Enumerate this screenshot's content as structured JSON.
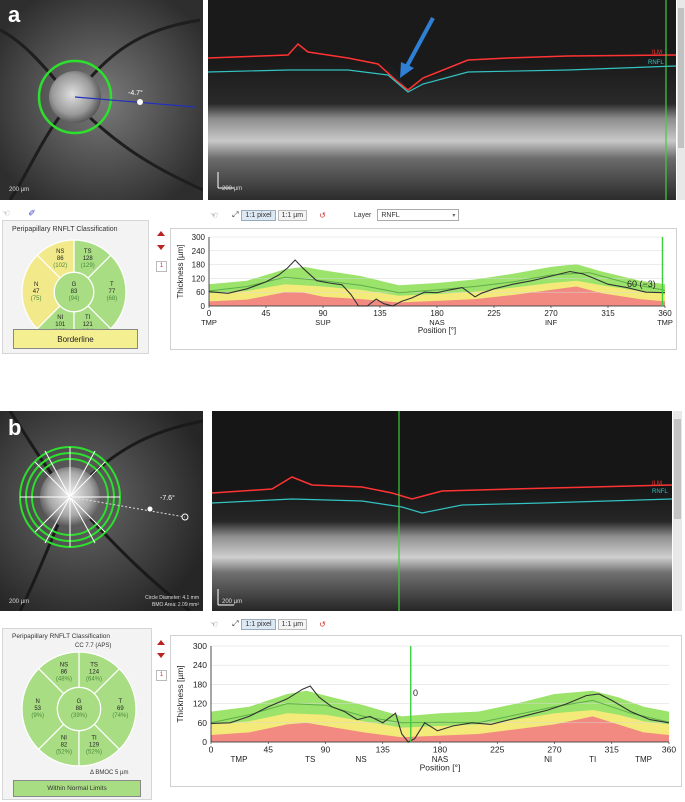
{
  "panels": [
    {
      "label": "a",
      "fundus": {
        "scale_bar": "200 µm",
        "angle_label": "-4.7°",
        "circle_diameter": "",
        "bmo_area": ""
      },
      "oct": {
        "scale_bar": "200 µm",
        "ilm_label": "ILM",
        "rnfl_label": "RNFL"
      },
      "toolbar": {
        "btn1": "1:1 pixel",
        "btn2": "1:1 µm",
        "layer_label": "Layer",
        "layer_value": "RNFL"
      },
      "classification": {
        "title": "Peripapillary RNFLT Classification",
        "extra": "",
        "bmoc": "",
        "sectors": {
          "NS": {
            "name": "NS",
            "value": "86",
            "ref": "(102)",
            "color": "#f2ea8a"
          },
          "TS": {
            "name": "TS",
            "value": "128",
            "ref": "(129)",
            "color": "#a9dd84"
          },
          "N": {
            "name": "N",
            "value": "47",
            "ref": "(75)",
            "color": "#f2ea8a"
          },
          "G": {
            "name": "G",
            "value": "83",
            "ref": "(94)",
            "color": "#a9dd84"
          },
          "T": {
            "name": "T",
            "value": "77",
            "ref": "(68)",
            "color": "#a9dd84"
          },
          "NI": {
            "name": "NI",
            "value": "101",
            "ref": "(103)",
            "color": "#a9dd84"
          },
          "TI": {
            "name": "TI",
            "value": "121",
            "ref": "(134)",
            "color": "#a9dd84"
          }
        },
        "status": "Borderline",
        "status_color": "#f4ef90"
      },
      "page": "1",
      "annotation": "60 (−3)"
    },
    {
      "label": "b",
      "fundus": {
        "scale_bar": "200 µm",
        "angle_label": "-7.6°",
        "circle_diameter": "Circle Diameter: 4.1 mm",
        "bmo_area": "BMO Area: 2.09 mm²"
      },
      "oct": {
        "scale_bar": "200 µm",
        "ilm_label": "ILM",
        "rnfl_label": "RNFL"
      },
      "toolbar": {
        "btn1": "1:1 pixel",
        "btn2": "1:1 µm",
        "layer_label": "",
        "layer_value": ""
      },
      "classification": {
        "title": "Peripapillary RNFLT Classification",
        "extra": "CC 7.7 (APS)",
        "bmoc": "Δ BMOC 5 µm",
        "sectors": {
          "NS": {
            "name": "NS",
            "value": "86",
            "ref": "(48%)",
            "color": "#a9dd84"
          },
          "TS": {
            "name": "TS",
            "value": "124",
            "ref": "(64%)",
            "color": "#a9dd84"
          },
          "N": {
            "name": "N",
            "value": "53",
            "ref": "(9%)",
            "color": "#a9dd84"
          },
          "G": {
            "name": "G",
            "value": "88",
            "ref": "(39%)",
            "color": "#a9dd84"
          },
          "T": {
            "name": "T",
            "value": "69",
            "ref": "(74%)",
            "color": "#a9dd84"
          },
          "NI": {
            "name": "NI",
            "value": "82",
            "ref": "(52%)",
            "color": "#a9dd84"
          },
          "TI": {
            "name": "TI",
            "value": "129",
            "ref": "(52%)",
            "color": "#a9dd84"
          }
        },
        "status": "Within Normal Limits",
        "status_color": "#a9dd84"
      },
      "page": "1",
      "annotation": "0"
    }
  ],
  "colors": {
    "ilm": "#ff3333",
    "rnfl": "#33c3c3",
    "cursor": "#3ccf3c",
    "arrow": "#2f7fd4",
    "normal_band": "#9be36a",
    "borderline_band": "#f4ea7a",
    "abnormal_band": "#f28a82"
  },
  "chart_data": [
    {
      "type": "line",
      "ylabel": "Thickness [µm]",
      "xlabel": "Position [°]",
      "ylim": [
        0,
        300
      ],
      "xlim": [
        0,
        360
      ],
      "yticks": [
        "0",
        "60",
        "120",
        "180",
        "240",
        "300"
      ],
      "xticks": [
        "0",
        "45",
        "90",
        "135",
        "180",
        "225",
        "270",
        "315",
        "360"
      ],
      "xcats": [
        "TMP",
        "SUP",
        "NAS",
        "INF",
        "TMP"
      ],
      "cursor_x": 358,
      "series": [
        {
          "values": [
            [
              0,
              62
            ],
            [
              15,
              55
            ],
            [
              30,
              75
            ],
            [
              45,
              105
            ],
            [
              55,
              135
            ],
            [
              62,
              165
            ],
            [
              68,
              200
            ],
            [
              75,
              160
            ],
            [
              85,
              110
            ],
            [
              95,
              100
            ],
            [
              105,
              92
            ],
            [
              112,
              50
            ],
            [
              118,
              0
            ],
            [
              125,
              0
            ],
            [
              132,
              30
            ],
            [
              138,
              10
            ],
            [
              145,
              0
            ],
            [
              152,
              20
            ],
            [
              160,
              35
            ],
            [
              170,
              60
            ],
            [
              180,
              58
            ],
            [
              190,
              70
            ],
            [
              200,
              80
            ],
            [
              210,
              40
            ],
            [
              215,
              55
            ],
            [
              225,
              75
            ],
            [
              240,
              95
            ],
            [
              255,
              110
            ],
            [
              270,
              130
            ],
            [
              285,
              150
            ],
            [
              295,
              140
            ],
            [
              305,
              118
            ],
            [
              315,
              95
            ],
            [
              330,
              80
            ],
            [
              345,
              60
            ],
            [
              360,
              58
            ]
          ]
        },
        {
          "values": [
            [
              0,
              65
            ],
            [
              30,
              85
            ],
            [
              60,
              125
            ],
            [
              90,
              110
            ],
            [
              120,
              90
            ],
            [
              150,
              58
            ],
            [
              180,
              70
            ],
            [
              210,
              85
            ],
            [
              240,
              105
            ],
            [
              270,
              135
            ],
            [
              300,
              145
            ],
            [
              330,
              100
            ],
            [
              360,
              68
            ]
          ]
        }
      ],
      "bands": {
        "normal_upper": [
          [
            0,
            95
          ],
          [
            30,
            110
          ],
          [
            60,
            160
          ],
          [
            75,
            170
          ],
          [
            90,
            155
          ],
          [
            120,
            130
          ],
          [
            150,
            90
          ],
          [
            180,
            100
          ],
          [
            210,
            115
          ],
          [
            240,
            140
          ],
          [
            270,
            170
          ],
          [
            290,
            182
          ],
          [
            310,
            150
          ],
          [
            340,
            110
          ],
          [
            360,
            95
          ]
        ],
        "borderline_upper": [
          [
            0,
            55
          ],
          [
            30,
            65
          ],
          [
            60,
            95
          ],
          [
            90,
            85
          ],
          [
            120,
            70
          ],
          [
            150,
            45
          ],
          [
            180,
            52
          ],
          [
            210,
            62
          ],
          [
            240,
            80
          ],
          [
            270,
            100
          ],
          [
            290,
            110
          ],
          [
            310,
            90
          ],
          [
            340,
            65
          ],
          [
            360,
            55
          ]
        ],
        "abnormal_upper": [
          [
            0,
            20
          ],
          [
            30,
            28
          ],
          [
            60,
            60
          ],
          [
            75,
            58
          ],
          [
            90,
            40
          ],
          [
            120,
            30
          ],
          [
            150,
            15
          ],
          [
            180,
            22
          ],
          [
            210,
            30
          ],
          [
            240,
            48
          ],
          [
            270,
            70
          ],
          [
            290,
            85
          ],
          [
            310,
            55
          ],
          [
            340,
            30
          ],
          [
            360,
            20
          ]
        ]
      }
    },
    {
      "type": "line",
      "ylabel": "Thickness [µm]",
      "xlabel": "Position [°]",
      "ylim": [
        0,
        300
      ],
      "xlim": [
        0,
        360
      ],
      "yticks": [
        "0",
        "60",
        "120",
        "180",
        "240",
        "300"
      ],
      "xticks": [
        "0",
        "45",
        "90",
        "135",
        "180",
        "225",
        "270",
        "315",
        "360"
      ],
      "xcats": [
        "TMP",
        "TS",
        "NS",
        "NAS",
        "NI",
        "TI",
        "TMP"
      ],
      "cursor_x": 157,
      "series": [
        {
          "values": [
            [
              0,
              58
            ],
            [
              15,
              60
            ],
            [
              30,
              80
            ],
            [
              45,
              110
            ],
            [
              60,
              135
            ],
            [
              72,
              165
            ],
            [
              78,
              175
            ],
            [
              85,
              140
            ],
            [
              95,
              110
            ],
            [
              105,
              95
            ],
            [
              115,
              70
            ],
            [
              125,
              80
            ],
            [
              135,
              60
            ],
            [
              145,
              90
            ],
            [
              150,
              25
            ],
            [
              155,
              0
            ],
            [
              160,
              10
            ],
            [
              168,
              60
            ],
            [
              178,
              35
            ],
            [
              190,
              50
            ],
            [
              205,
              60
            ],
            [
              220,
              55
            ],
            [
              235,
              70
            ],
            [
              250,
              85
            ],
            [
              265,
              100
            ],
            [
              280,
              120
            ],
            [
              295,
              145
            ],
            [
              305,
              150
            ],
            [
              315,
              130
            ],
            [
              330,
              95
            ],
            [
              345,
              70
            ],
            [
              360,
              60
            ]
          ]
        },
        {
          "values": [
            [
              0,
              60
            ],
            [
              30,
              85
            ],
            [
              60,
              120
            ],
            [
              90,
              115
            ],
            [
              120,
              80
            ],
            [
              150,
              60
            ],
            [
              180,
              62
            ],
            [
              210,
              60
            ],
            [
              240,
              85
            ],
            [
              270,
              110
            ],
            [
              300,
              130
            ],
            [
              330,
              90
            ],
            [
              360,
              62
            ]
          ]
        }
      ],
      "bands": {
        "normal_upper": [
          [
            0,
            95
          ],
          [
            30,
            110
          ],
          [
            60,
            150
          ],
          [
            75,
            160
          ],
          [
            90,
            145
          ],
          [
            120,
            115
          ],
          [
            150,
            80
          ],
          [
            180,
            90
          ],
          [
            210,
            95
          ],
          [
            240,
            120
          ],
          [
            270,
            150
          ],
          [
            300,
            160
          ],
          [
            320,
            140
          ],
          [
            340,
            110
          ],
          [
            360,
            95
          ]
        ],
        "borderline_upper": [
          [
            0,
            55
          ],
          [
            30,
            65
          ],
          [
            60,
            90
          ],
          [
            90,
            85
          ],
          [
            120,
            65
          ],
          [
            150,
            45
          ],
          [
            180,
            50
          ],
          [
            210,
            55
          ],
          [
            240,
            70
          ],
          [
            270,
            90
          ],
          [
            300,
            100
          ],
          [
            320,
            85
          ],
          [
            340,
            65
          ],
          [
            360,
            55
          ]
        ],
        "abnormal_upper": [
          [
            0,
            22
          ],
          [
            30,
            30
          ],
          [
            60,
            55
          ],
          [
            75,
            60
          ],
          [
            90,
            50
          ],
          [
            120,
            30
          ],
          [
            150,
            15
          ],
          [
            180,
            20
          ],
          [
            210,
            25
          ],
          [
            240,
            40
          ],
          [
            270,
            55
          ],
          [
            300,
            80
          ],
          [
            320,
            55
          ],
          [
            340,
            30
          ],
          [
            360,
            22
          ]
        ]
      }
    }
  ]
}
